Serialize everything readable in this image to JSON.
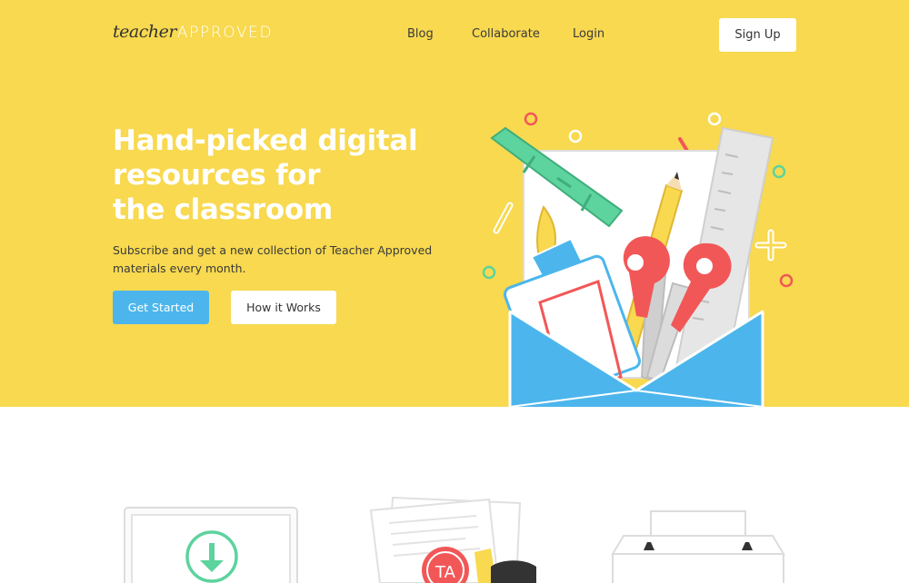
{
  "header": {
    "logo_script": "teacher",
    "logo_caps": "APPROVED",
    "nav": {
      "blog": "Blog",
      "collaborate": "Collaborate",
      "login": "Login",
      "signup": "Sign Up"
    }
  },
  "hero": {
    "headline_line1": "Hand-picked digital",
    "headline_line2": "resources for",
    "headline_line3": "the classroom",
    "subtitle_line1": "Subscribe and get a new collection of Teacher Approved",
    "subtitle_line2": "materials every month.",
    "primary_button": "Get Started",
    "secondary_button": "How it Works",
    "stamp_text": "TA"
  },
  "colors": {
    "hero_bg": "#f8d94f",
    "primary": "#4cb6ec",
    "envelope": "#4cb6ec",
    "scissors": "#f25757",
    "crayon": "#5dd39e"
  },
  "icons": [
    "envelope-illustration",
    "crayon-icon",
    "pencil-icon",
    "ruler-icon",
    "scissors-icon",
    "glue-icon",
    "download-icon",
    "documents-icon",
    "printer-icon"
  ]
}
